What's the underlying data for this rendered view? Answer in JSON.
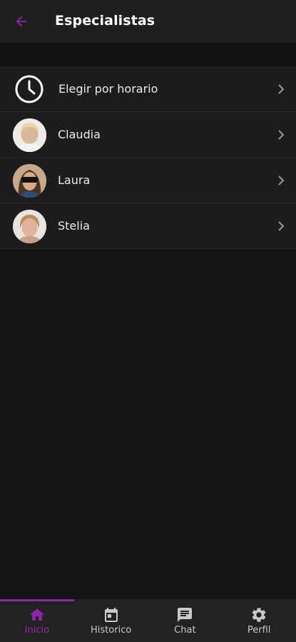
{
  "header": {
    "title": "Especialistas",
    "back_icon": "arrow-left-icon"
  },
  "colors": {
    "accent": "#9c27b0",
    "background": "#141414",
    "surface": "#1f1f1f"
  },
  "list": {
    "items": [
      {
        "label": "Elegir por horario",
        "icon": "clock-icon"
      },
      {
        "label": "Claudia",
        "icon": "avatar"
      },
      {
        "label": "Laura",
        "icon": "avatar"
      },
      {
        "label": "Stelia",
        "icon": "avatar"
      }
    ]
  },
  "nav": {
    "items": [
      {
        "label": "Inicio",
        "icon": "home-icon",
        "active": true
      },
      {
        "label": "Historico",
        "icon": "calendar-icon",
        "active": false
      },
      {
        "label": "Chat",
        "icon": "chat-icon",
        "active": false
      },
      {
        "label": "Perfil",
        "icon": "gear-icon",
        "active": false
      }
    ]
  }
}
